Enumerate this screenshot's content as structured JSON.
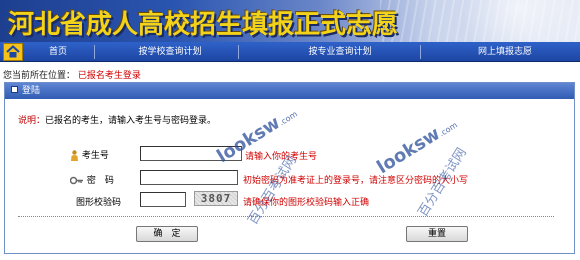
{
  "banner": {
    "title": "河北省成人高校招生填报正式志愿"
  },
  "nav": {
    "items": [
      {
        "label": "首页"
      },
      {
        "label": "按学校查询计划"
      },
      {
        "label": "按专业查询计划"
      },
      {
        "label": "网上填报志愿"
      }
    ]
  },
  "location": {
    "prefix": "您当前所在位置：",
    "current": "已报名考生登录"
  },
  "panel": {
    "title": "登陆"
  },
  "note": {
    "label": "说明：",
    "text": "已报名的考生，请输入考生号与密码登录。"
  },
  "form": {
    "exam_no": {
      "label": "考生号",
      "hint": "请输入你的考生号",
      "value": ""
    },
    "password": {
      "label": "密　码",
      "hint": "初始密码为准考证上的登录号，请注意区分密码的大小写",
      "value": ""
    },
    "captcha": {
      "label": "图形校验码",
      "image_text": "3807",
      "hint": "请确保你的图形校验码输入正确",
      "value": ""
    }
  },
  "buttons": {
    "confirm": "确　定",
    "reset": "重置"
  },
  "watermarks": [
    {
      "brand": "looksw",
      "domain": ".com",
      "cn": "百分百考试网"
    },
    {
      "brand": "looksw",
      "domain": ".com",
      "cn": "百分百考试网"
    }
  ]
}
